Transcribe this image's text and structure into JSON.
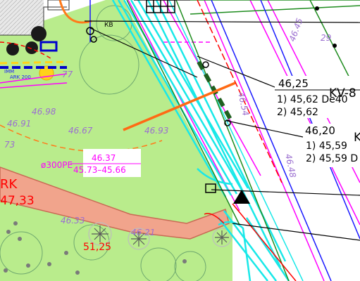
{
  "map": {
    "colors": {
      "grass": "#b9ec8c",
      "road": "#f1a48c",
      "road_edge": "#c96a55",
      "pipe_cyan": "#19e8e8",
      "pipe_blue": "#1a1aff",
      "magenta": "#ff00ff",
      "green_line": "#1e8c1e",
      "dark_green": "#1f5f1f",
      "orange": "#ff6a14",
      "red": "#ff0000",
      "elev_text": "#9b6fd0"
    },
    "elevations": {
      "e46_98": "46.98",
      "e46_91": "46.91",
      "e46_67": "46.67",
      "e46_93": "46.93",
      "e_73": "73",
      "e_77": "77",
      "e46_33": "46.33",
      "e46_21": "46.21",
      "e46_54": "46.54",
      "e46_48": "46.48",
      "e46_45": "46.45",
      "e_29": "29"
    },
    "pipe_tag": "ø300PE",
    "level_top": "46.37",
    "level_bottom": "45.73–45.66",
    "road_label": "RK",
    "road_level": "47,33",
    "red_level": "51,25",
    "well1": {
      "top": "46,25",
      "name": "KV-8",
      "line1": "1) 45,62 De40",
      "line2": "2) 45,62"
    },
    "well2": {
      "top": "46,20",
      "name": "K",
      "line1": "1) 45,59",
      "line2": "2) 45,59 D"
    },
    "building_label": "КВ",
    "pipe_labels": {
      "p1": "IMM",
      "p2": "ARK 200"
    }
  }
}
